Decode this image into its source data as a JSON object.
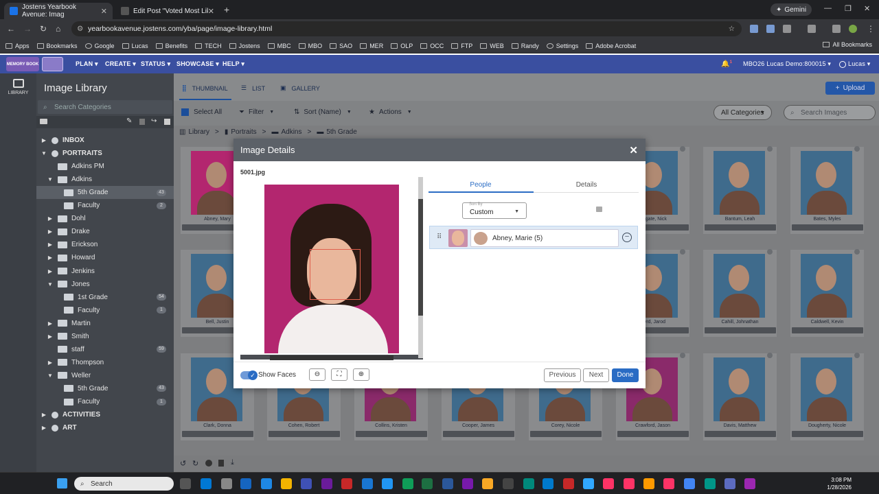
{
  "browser": {
    "tabs": [
      {
        "title": "Jostens Yearbook Avenue: Imag",
        "active": true
      },
      {
        "title": "Edit Post \"Voted Most Likely To",
        "active": false
      }
    ],
    "gemini_label": "Gemini",
    "url": "yearbookavenue.jostens.com/yba/page/image-library.html",
    "bookmarks": [
      "Apps",
      "Bookmarks",
      "Google",
      "Lucas",
      "Benefits",
      "TECH",
      "Jostens",
      "MBC",
      "MBO",
      "SAO",
      "MER",
      "OLP",
      "OCC",
      "FTP",
      "WEB",
      "Randy",
      "Settings",
      "Adobe Acrobat"
    ],
    "all_bookmarks": "All Bookmarks"
  },
  "app": {
    "logo_text": "MEMORY BOOK",
    "menu": [
      "PLAN ▾",
      "CREATE ▾",
      "STATUS ▾",
      "SHOWCASE ▾",
      "HELP ▾"
    ],
    "notification_count": "1",
    "account": "MBO26 Lucas Demo:800015 ▾",
    "user": "Lucas ▾",
    "rail_label": "LIBRARY"
  },
  "sidebar": {
    "title": "Image Library",
    "search_placeholder": "Search Categories",
    "tree": [
      {
        "label": "INBOX",
        "level": 0,
        "caret": "▶",
        "bold": true,
        "count": ""
      },
      {
        "label": "PORTRAITS",
        "level": 0,
        "caret": "▼",
        "bold": true,
        "count": ""
      },
      {
        "label": "Adkins PM",
        "level": 1,
        "caret": "",
        "bold": false,
        "count": ""
      },
      {
        "label": "Adkins",
        "level": 1,
        "caret": "▼",
        "bold": false,
        "count": ""
      },
      {
        "label": "5th Grade",
        "level": 2,
        "caret": "",
        "bold": false,
        "count": "43",
        "selected": true
      },
      {
        "label": "Faculty",
        "level": 2,
        "caret": "",
        "bold": false,
        "count": "2"
      },
      {
        "label": "Dohl",
        "level": 1,
        "caret": "▶",
        "bold": false,
        "count": ""
      },
      {
        "label": "Drake",
        "level": 1,
        "caret": "▶",
        "bold": false,
        "count": ""
      },
      {
        "label": "Erickson",
        "level": 1,
        "caret": "▶",
        "bold": false,
        "count": ""
      },
      {
        "label": "Howard",
        "level": 1,
        "caret": "▶",
        "bold": false,
        "count": ""
      },
      {
        "label": "Jenkins",
        "level": 1,
        "caret": "▶",
        "bold": false,
        "count": ""
      },
      {
        "label": "Jones",
        "level": 1,
        "caret": "▼",
        "bold": false,
        "count": ""
      },
      {
        "label": "1st Grade",
        "level": 2,
        "caret": "",
        "bold": false,
        "count": "54"
      },
      {
        "label": "Faculty",
        "level": 2,
        "caret": "",
        "bold": false,
        "count": "1"
      },
      {
        "label": "Martin",
        "level": 1,
        "caret": "▶",
        "bold": false,
        "count": ""
      },
      {
        "label": "Smith",
        "level": 1,
        "caret": "▶",
        "bold": false,
        "count": ""
      },
      {
        "label": "staff",
        "level": 1,
        "caret": "",
        "bold": false,
        "count": "59"
      },
      {
        "label": "Thompson",
        "level": 1,
        "caret": "▶",
        "bold": false,
        "count": ""
      },
      {
        "label": "Weller",
        "level": 1,
        "caret": "▼",
        "bold": false,
        "count": ""
      },
      {
        "label": "5th Grade",
        "level": 2,
        "caret": "",
        "bold": false,
        "count": "43"
      },
      {
        "label": "Faculty",
        "level": 2,
        "caret": "",
        "bold": false,
        "count": "1"
      },
      {
        "label": "ACTIVITIES",
        "level": 0,
        "caret": "▶",
        "bold": true,
        "count": ""
      },
      {
        "label": "ART",
        "level": 0,
        "caret": "▶",
        "bold": true,
        "count": ""
      }
    ]
  },
  "main": {
    "view_tabs": [
      "THUMBNAIL",
      "LIST",
      "GALLERY"
    ],
    "upload": "Upload",
    "toolbar": {
      "select_all": "Select All",
      "filter": "Filter",
      "sort": "Sort (Name)",
      "actions": "Actions"
    },
    "all_categories": "All Categories",
    "search_placeholder": "Search Images",
    "breadcrumb": [
      "Library",
      "Portraits",
      "Adkins",
      "5th Grade"
    ],
    "cards": [
      {
        "name": "Abney, Mary"
      },
      {
        "name": ""
      },
      {
        "name": ""
      },
      {
        "name": ""
      },
      {
        "name": ""
      },
      {
        "name": "...egate, Nick"
      },
      {
        "name": "Bantum, Leah"
      },
      {
        "name": "Bates, Myles"
      },
      {
        "name": "Bell, Justin"
      },
      {
        "name": ""
      },
      {
        "name": ""
      },
      {
        "name": ""
      },
      {
        "name": ""
      },
      {
        "name": "...yrd, Jarod"
      },
      {
        "name": "Cahill, Johnathan"
      },
      {
        "name": "Caldwell, Kevin"
      },
      {
        "name": "Clark, Donna"
      },
      {
        "name": "Cohen, Robert"
      },
      {
        "name": "Collins, Kristen"
      },
      {
        "name": "Cooper, James"
      },
      {
        "name": "Corey, Nicole"
      },
      {
        "name": "Crawford, Jason"
      },
      {
        "name": "Davis, Matthew"
      },
      {
        "name": "Dougherty, Nicole"
      }
    ]
  },
  "modal": {
    "title": "Image Details",
    "filename": "5001.jpg",
    "tabs": [
      "People",
      "Details"
    ],
    "sort_by_label": "Sort By",
    "sort_by_value": "Custom",
    "person_name": "Abney, Marie (5)",
    "show_faces": "Show Faces",
    "previous": "Previous",
    "next": "Next",
    "done": "Done"
  },
  "taskbar": {
    "search": "Search",
    "time": "3:08 PM",
    "date": "1/28/2026"
  }
}
